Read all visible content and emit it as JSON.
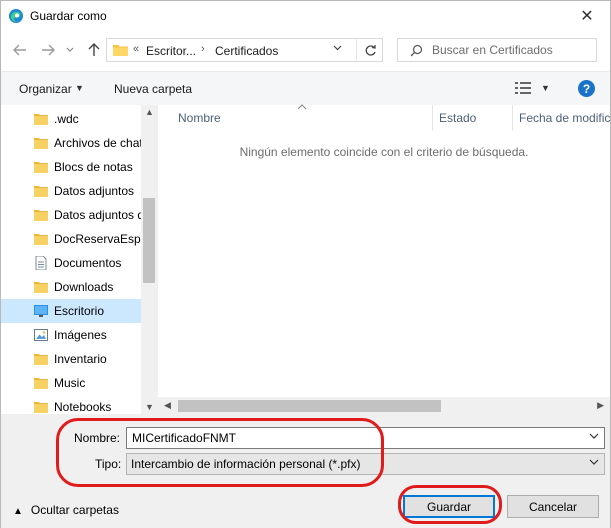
{
  "window": {
    "title": "Guardar como",
    "close_symbol": "✕"
  },
  "address_bar": {
    "overflow_symbol": "«",
    "segments": [
      "Escritor...",
      "Certificados"
    ],
    "separator": "›"
  },
  "search": {
    "placeholder": "Buscar en Certificados"
  },
  "toolbar": {
    "organize_label": "Organizar",
    "new_folder_label": "Nueva carpeta",
    "help_label": "?"
  },
  "nav_pane": {
    "items": [
      {
        "label": ".wdc",
        "icon": "folder-icon"
      },
      {
        "label": "Archivos de chat",
        "icon": "folder-icon"
      },
      {
        "label": "Blocs de notas",
        "icon": "folder-icon"
      },
      {
        "label": "Datos adjuntos",
        "icon": "folder-icon"
      },
      {
        "label": "Datos adjuntos d",
        "icon": "folder-icon"
      },
      {
        "label": "DocReservaEspa",
        "icon": "folder-icon"
      },
      {
        "label": "Documentos",
        "icon": "document-folder-icon"
      },
      {
        "label": "Downloads",
        "icon": "folder-icon"
      },
      {
        "label": "Escritorio",
        "icon": "desktop-icon",
        "selected": true
      },
      {
        "label": "Imágenes",
        "icon": "pictures-icon"
      },
      {
        "label": "Inventario",
        "icon": "folder-icon"
      },
      {
        "label": "Music",
        "icon": "folder-icon"
      },
      {
        "label": "Notebooks",
        "icon": "folder-icon"
      }
    ]
  },
  "file_list": {
    "columns": [
      "Nombre",
      "Estado",
      "Fecha de modific"
    ],
    "empty_message": "Ningún elemento coincide con el criterio de búsqueda."
  },
  "form": {
    "name_label": "Nombre:",
    "name_value": "MICertificadoFNMT",
    "type_label": "Tipo:",
    "type_value": "Intercambio de información personal (*.pfx)"
  },
  "footer": {
    "hide_folders_label": "Ocultar carpetas",
    "save_label": "Guardar",
    "cancel_label": "Cancelar"
  },
  "colors": {
    "accent": "#0078d7",
    "selection": "#cce8ff",
    "annotation": "#e01b1b",
    "folder": "#f5c542"
  }
}
